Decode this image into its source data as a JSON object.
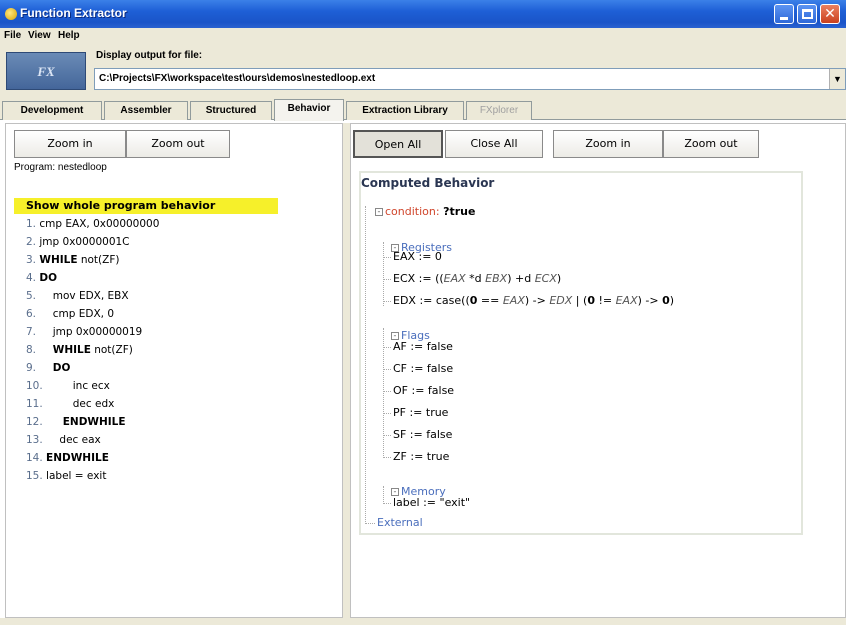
{
  "window": {
    "title": "Function Extractor"
  },
  "menu": [
    "File",
    "View",
    "Help"
  ],
  "file_header": {
    "logo_text": "FX",
    "display_label": "Display output for file:",
    "path": "C:\\Projects\\FX\\workspace\\test\\ours\\demos\\nestedloop.ext"
  },
  "tabs": [
    "Development",
    "Assembler",
    "Structured",
    "Behavior",
    "Extraction Library",
    "FXplorer"
  ],
  "left": {
    "zoom_in": "Zoom in",
    "zoom_out": "Zoom out",
    "program_label": "Program: nestedloop",
    "highlight": "Show whole program behavior",
    "lines": [
      {
        "n": "1.",
        "text": "cmp EAX, 0x00000000"
      },
      {
        "n": "2.",
        "text": "jmp 0x0000001C"
      },
      {
        "n": "3.",
        "kw": "WHILE",
        "text": " not(ZF)"
      },
      {
        "n": "4.",
        "kw": "DO",
        "text": ""
      },
      {
        "n": "5.",
        "text": "mov EDX, EBX"
      },
      {
        "n": "6.",
        "text": "cmp EDX, 0"
      },
      {
        "n": "7.",
        "text": "jmp 0x00000019"
      },
      {
        "n": "8.",
        "kw": "WHILE",
        "text": " not(ZF)"
      },
      {
        "n": "9.",
        "kw": "DO",
        "text": ""
      },
      {
        "n": "10.",
        "text": "inc ecx"
      },
      {
        "n": "11.",
        "text": "dec edx"
      },
      {
        "n": "12.",
        "kw": "ENDWHILE",
        "text": ""
      },
      {
        "n": "13.",
        "text": "dec eax"
      },
      {
        "n": "14.",
        "kw": "ENDWHILE",
        "text": ""
      },
      {
        "n": "15.",
        "text": "label = exit"
      }
    ]
  },
  "right": {
    "open_all": "Open All",
    "close_all": "Close All",
    "zoom_in": "Zoom in",
    "zoom_out": "Zoom out",
    "title": "Computed Behavior",
    "condition_label": "condition:",
    "condition_value": "?true",
    "registers_label": "Registers",
    "eax": "EAX := 0",
    "ecx_prefix": "ECX := ((",
    "ecx_a": "EAX",
    "ecx_mid": " *d ",
    "ecx_b": "EBX",
    "ecx_mid2": ") +d ",
    "ecx_c": "ECX",
    "ecx_end": ")",
    "edx_prefix": "EDX := case((",
    "edx_zero1": "0",
    "edx_eq": " == ",
    "edx_eax1": "EAX",
    "edx_arrow1": ") -> ",
    "edx_edx": "EDX",
    "edx_bar": " | (",
    "edx_zero2": "0",
    "edx_ne": " != ",
    "edx_eax2": "EAX",
    "edx_arrow2": ") -> ",
    "edx_zero3": "0",
    "edx_end": ")",
    "flags_label": "Flags",
    "flags": [
      "AF := false",
      "CF := false",
      "OF := false",
      "PF := true",
      "SF := false",
      "ZF := true"
    ],
    "memory_label": "Memory",
    "memory_value": "label := \"exit\"",
    "external_label": "External"
  }
}
